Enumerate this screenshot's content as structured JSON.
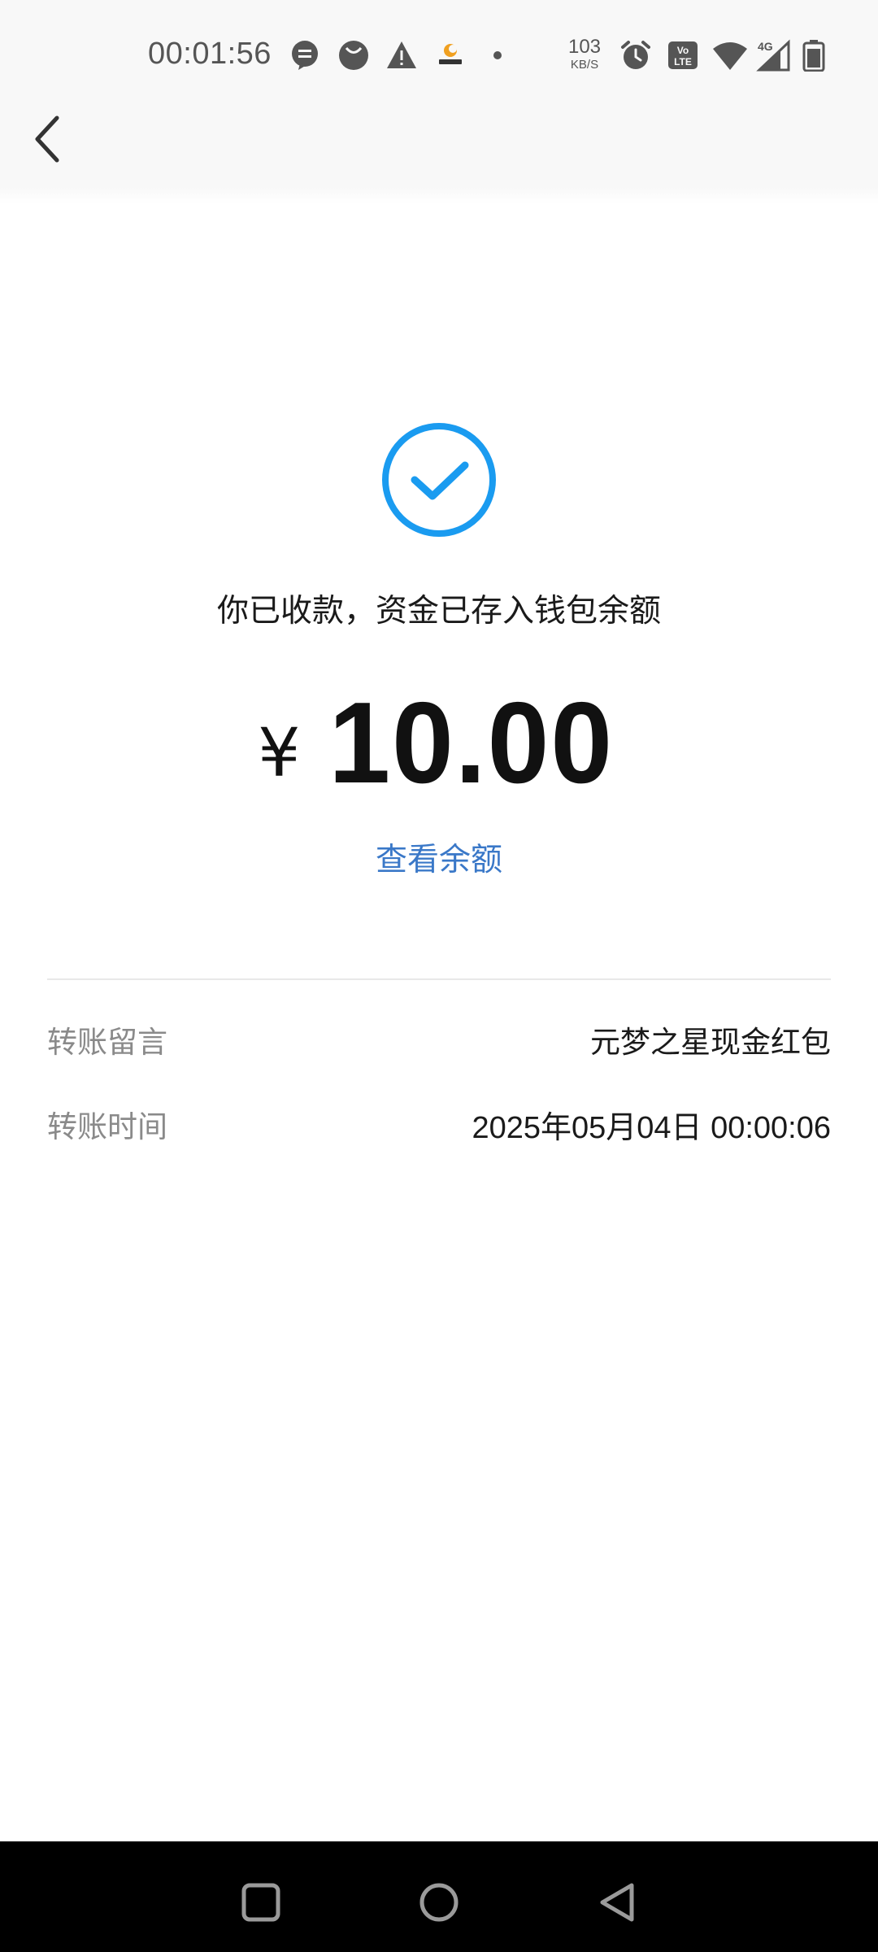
{
  "status_bar": {
    "time": "00:01:56",
    "net_speed_value": "103",
    "net_speed_unit": "KB/S",
    "network_type": "4G",
    "icons": [
      "chat-bubble-icon",
      "circle-app-icon",
      "warning-icon",
      "app-logo-icon",
      "dot-icon",
      "alarm-icon",
      "volte-icon",
      "wifi-icon",
      "signal-icon",
      "battery-icon"
    ]
  },
  "header": {
    "back_icon": "chevron-left-icon"
  },
  "success": {
    "icon": "check-circle-icon",
    "message": "你已收款，资金已存入钱包余额",
    "currency_symbol": "¥",
    "amount": "10.00",
    "view_balance_label": "查看余额"
  },
  "details": [
    {
      "label": "转账留言",
      "value": "元梦之星现金红包"
    },
    {
      "label": "转账时间",
      "value": "2025年05月04日 00:00:06"
    }
  ],
  "navigation": {
    "buttons": [
      "recents-square-icon",
      "home-circle-icon",
      "back-triangle-icon"
    ]
  },
  "colors": {
    "accent_blue": "#1a9bf0",
    "link_blue": "#3a78c8",
    "label_gray": "#8a8a8a",
    "text_dark": "#1a1a1a"
  }
}
